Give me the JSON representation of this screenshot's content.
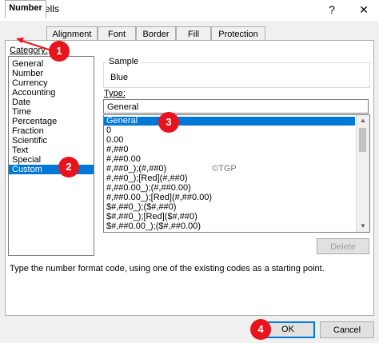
{
  "window": {
    "title": "Format Cells",
    "help": "?",
    "close": "✕"
  },
  "tabs": [
    {
      "label": "Number"
    },
    {
      "label": "Alignment"
    },
    {
      "label": "Font"
    },
    {
      "label": "Border"
    },
    {
      "label": "Fill"
    },
    {
      "label": "Protection"
    }
  ],
  "category": {
    "label": "Category:",
    "items": [
      "General",
      "Number",
      "Currency",
      "Accounting",
      "Date",
      "Time",
      "Percentage",
      "Fraction",
      "Scientific",
      "Text",
      "Special",
      "Custom"
    ],
    "selected": "Custom"
  },
  "sample": {
    "label": "Sample",
    "value": "Blue"
  },
  "type": {
    "label": "Type:",
    "input_value": "General",
    "codes": [
      "General",
      "0",
      "0.00",
      "#,##0",
      "#,##0.00",
      "#,##0_);(#,##0)",
      "#,##0_);[Red](#,##0)",
      "#,##0.00_);(#,##0.00)",
      "#,##0.00_);[Red](#,##0.00)",
      "$#,##0_);($#,##0)",
      "$#,##0_);[Red]($#,##0)",
      "$#,##0.00_);($#,##0.00)"
    ],
    "selected": "General"
  },
  "buttons": {
    "delete": "Delete",
    "ok": "OK",
    "cancel": "Cancel"
  },
  "description": "Type the number format code, using one of the existing codes as a starting point.",
  "watermark": "©TGP",
  "badges": [
    "1",
    "2",
    "3",
    "4"
  ],
  "colors": {
    "selection": "#0078d7",
    "badge": "#e8141b"
  }
}
